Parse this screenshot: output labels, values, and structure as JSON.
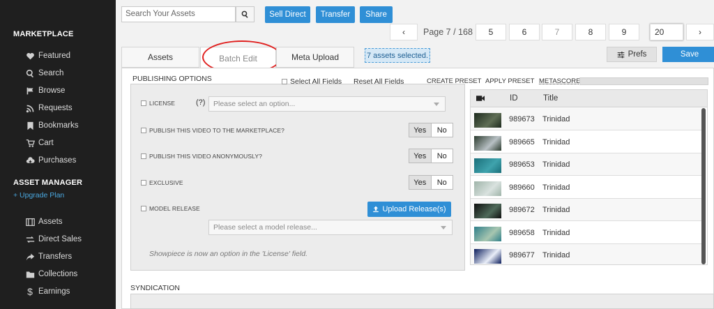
{
  "sidebar": {
    "marketplace_heading": "MARKETPLACE",
    "marketplace_items": [
      {
        "label": "Featured",
        "icon": "heart-icon"
      },
      {
        "label": "Search",
        "icon": "search-icon"
      },
      {
        "label": "Browse",
        "icon": "flag-icon"
      },
      {
        "label": "Requests",
        "icon": "rss-icon"
      },
      {
        "label": "Bookmarks",
        "icon": "bookmark-icon"
      },
      {
        "label": "Cart",
        "icon": "cart-icon"
      },
      {
        "label": "Purchases",
        "icon": "cloud-download-icon"
      }
    ],
    "asset_manager_heading": "ASSET MANAGER",
    "upgrade_label": "+ Upgrade Plan",
    "asset_items": [
      {
        "label": "Assets",
        "icon": "film-icon"
      },
      {
        "label": "Direct Sales",
        "icon": "exchange-icon"
      },
      {
        "label": "Transfers",
        "icon": "share-icon"
      },
      {
        "label": "Collections",
        "icon": "folder-icon"
      },
      {
        "label": "Earnings",
        "icon": "dollar-icon"
      }
    ]
  },
  "toolbar": {
    "search_placeholder": "Search Your Assets",
    "sell_direct_label": "Sell Direct",
    "transfer_label": "Transfer",
    "share_label": "Share"
  },
  "pager": {
    "label": "Page 7 / 168",
    "pages": [
      "5",
      "6",
      "7",
      "8",
      "9"
    ],
    "per_page": "20",
    "prev": "‹",
    "next": "›"
  },
  "tabs": {
    "assets": "Assets",
    "batch_edit": "Batch Edit",
    "meta_upload": "Meta Upload"
  },
  "selected_badge": "7 assets selected.",
  "prefs_label": "Prefs",
  "save_label": "Save",
  "publishing": {
    "title": "PUBLISHING OPTIONS",
    "select_all": "Select All Fields",
    "reset_all": "Reset All Fields",
    "create_preset": "CREATE PRESET",
    "apply_preset": "APPLY PRESET",
    "metascore": "METASCORE",
    "license_label": "LICENSE",
    "license_help": "(?)",
    "license_placeholder": "Please select an option...",
    "publish_marketplace": "PUBLISH THIS VIDEO TO THE MARKETPLACE?",
    "publish_anon": "PUBLISH THIS VIDEO ANONYMOUSLY?",
    "exclusive": "EXCLUSIVE",
    "model_release": "MODEL RELEASE",
    "model_release_placeholder": "Please select a model release...",
    "upload_label": "Upload Release(s)",
    "yes": "Yes",
    "no": "No",
    "note": "Showpiece is now an option in the 'License' field."
  },
  "table": {
    "col_id": "ID",
    "col_title": "Title",
    "rows": [
      {
        "id": "989673",
        "title": "Trinidad",
        "colors": [
          "#1d2a1e",
          "#5f6e55"
        ]
      },
      {
        "id": "989665",
        "title": "Trinidad",
        "colors": [
          "#2b3b2e",
          "#b8c0c4"
        ]
      },
      {
        "id": "989653",
        "title": "Trinidad",
        "colors": [
          "#1a6f7a",
          "#3fa3ad"
        ]
      },
      {
        "id": "989660",
        "title": "Trinidad",
        "colors": [
          "#9fb4a9",
          "#d9e2df"
        ]
      },
      {
        "id": "989672",
        "title": "Trinidad",
        "colors": [
          "#0f0f0f",
          "#4f6a5a"
        ]
      },
      {
        "id": "989658",
        "title": "Trinidad",
        "colors": [
          "#2f7f8a",
          "#a7c6b0"
        ]
      },
      {
        "id": "989677",
        "title": "Trinidad",
        "colors": [
          "#0b1d5c",
          "#e9eef8"
        ]
      }
    ]
  },
  "syndication_title": "SYNDICATION"
}
